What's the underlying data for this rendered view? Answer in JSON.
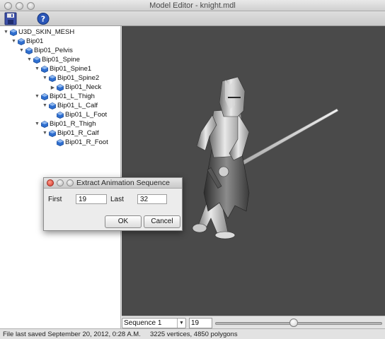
{
  "window": {
    "title": "Model Editor - knight.mdl"
  },
  "toolbar": {
    "save_icon": "floppy-disk-save-icon",
    "help_icon": "help-question-icon"
  },
  "tree": {
    "nodes": [
      {
        "label": "U3D_SKIN_MESH",
        "expanded": true
      },
      {
        "label": "Bip01",
        "expanded": true
      },
      {
        "label": "Bip01_Pelvis",
        "expanded": true
      },
      {
        "label": "Bip01_Spine",
        "expanded": true
      },
      {
        "label": "Bip01_Spine1",
        "expanded": true
      },
      {
        "label": "Bip01_Spine2",
        "expanded": true
      },
      {
        "label": "Bip01_Neck",
        "expanded": false
      },
      {
        "label": "Bip01_L_Thigh",
        "expanded": true
      },
      {
        "label": "Bip01_L_Calf",
        "expanded": true
      },
      {
        "label": "Bip01_L_Foot",
        "expanded": null
      },
      {
        "label": "Bip01_R_Thigh",
        "expanded": true
      },
      {
        "label": "Bip01_R_Calf",
        "expanded": true
      },
      {
        "label": "Bip01_R_Foot",
        "expanded": null
      }
    ]
  },
  "dialog": {
    "title": "Extract Animation Sequence",
    "first_label": "First",
    "first_value": "19",
    "last_label": "Last",
    "last_value": "32",
    "ok_label": "OK",
    "cancel_label": "Cancel"
  },
  "playback": {
    "sequence_selected": "Sequence 1",
    "frame_value": "19",
    "slider_position": 0.47
  },
  "status": {
    "left": "File last saved September 20, 2012, 0:28 A.M.",
    "right": "3225 vertices, 4850 polygons"
  },
  "colors": {
    "viewport_bg": "#4a4a4a",
    "close_red": "#d2362a",
    "node_icon_blue": "#2f6fd0"
  }
}
